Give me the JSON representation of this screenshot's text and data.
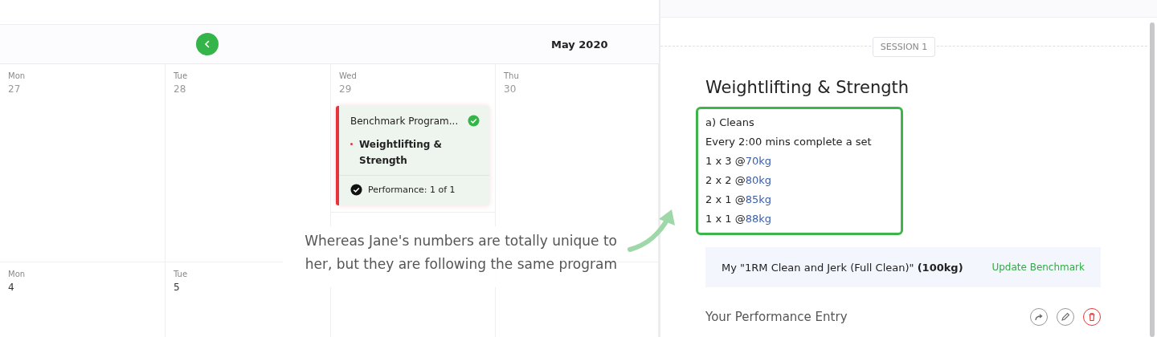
{
  "calendar": {
    "month": "May 2020",
    "weeks": [
      [
        {
          "day": "Mon",
          "date": "27"
        },
        {
          "day": "Tue",
          "date": "28"
        },
        {
          "day": "Wed",
          "date": "29",
          "events": [
            {
              "title": "Benchmark Program...",
              "completed": true,
              "items": [
                "Weightlifting & Strength"
              ],
              "performance": "Performance: 1 of 1",
              "performance_done": true
            }
          ]
        },
        {
          "day": "Thu",
          "date": "30"
        }
      ],
      [
        {
          "day": "Mon",
          "date": "4"
        },
        {
          "day": "Tue",
          "date": "5"
        }
      ]
    ]
  },
  "caption": "Whereas Jane's numbers are totally unique to her, but they are following the same program",
  "detail": {
    "session": "SESSION 1",
    "title": "Weightlifting & Strength",
    "lines": [
      {
        "text": "a) Cleans"
      },
      {
        "text": "Every 2:00 mins complete a set"
      },
      {
        "text": "1 x 3 @",
        "weight": "70kg"
      },
      {
        "text": "2 x 2 @",
        "weight": "80kg"
      },
      {
        "text": "2 x 1 @",
        "weight": "85kg"
      },
      {
        "text": "1 x 1 @",
        "weight": "88kg"
      }
    ],
    "benchmark": "My \"1RM Clean and Jerk (Full Clean)\" **(100kg)**",
    "benchmark_action": "Update Benchmark",
    "entry_title": "Your Performance Entry"
  }
}
